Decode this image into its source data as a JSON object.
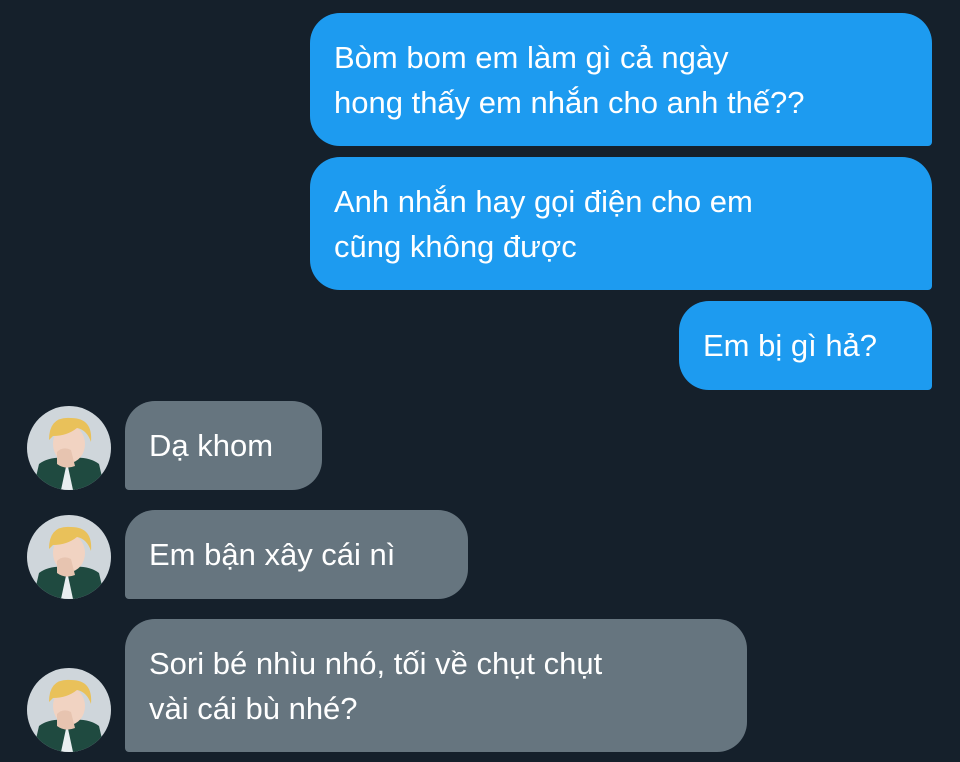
{
  "conversation": {
    "messages": [
      {
        "direction": "outgoing",
        "lines": [
          "Bòm bom em làm gì cả ngày",
          "hong thấy em nhắn cho anh thế??"
        ]
      },
      {
        "direction": "outgoing",
        "lines": [
          "Anh nhắn hay gọi điện cho em",
          "cũng không được"
        ]
      },
      {
        "direction": "outgoing",
        "lines": [
          "Em bị gì hả?"
        ]
      },
      {
        "direction": "incoming",
        "lines": [
          "Dạ khom"
        ]
      },
      {
        "direction": "incoming",
        "lines": [
          "Em bận xây cái nì"
        ]
      },
      {
        "direction": "incoming",
        "lines": [
          "Sori bé nhìu nhó, tối về chụt chụt",
          "vài cái bù nhé?"
        ]
      }
    ]
  },
  "colors": {
    "background": "#15202b",
    "outgoing_bubble": "#1d9bf0",
    "incoming_bubble": "#66757f",
    "text": "#ffffff"
  },
  "icons": {
    "contact_avatar": "avatar-photo-blonde-hair"
  }
}
